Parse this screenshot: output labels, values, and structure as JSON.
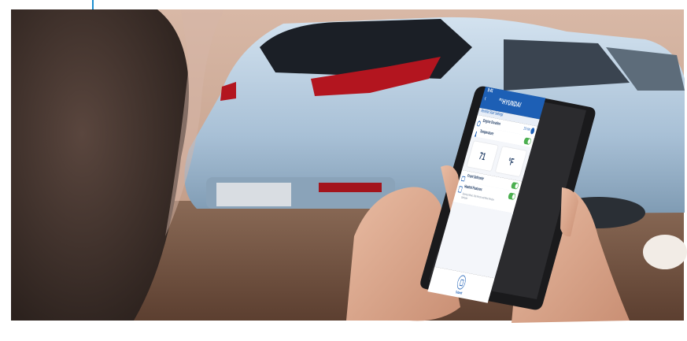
{
  "app": {
    "status_time": "9:41",
    "brand": "myHYUNDAI",
    "brand_prefix": "my",
    "brand_name": "HYUNDAI",
    "screen_title": "Remote Start Settings"
  },
  "settings": {
    "engine_duration": {
      "label": "Engine Duration",
      "value": "10 min"
    },
    "temperature": {
      "label": "Temperature",
      "enabled": true,
      "value": "71",
      "unit": "°F"
    },
    "front_defroster": {
      "label": "Front Defroster",
      "enabled": true
    },
    "heated_features": {
      "label": "Heated Features",
      "enabled": true,
      "description": "Steering Wheel, Side Mirrors and Rear Window Defroster"
    }
  },
  "footer": {
    "submit_label": "Submit"
  },
  "icons": [
    "back-arrow-icon",
    "engine-icon",
    "temperature-icon",
    "defroster-icon",
    "heated-features-icon",
    "submit-icon",
    "info-icon"
  ],
  "colors": {
    "accent": "#1d5fb5",
    "toggle_on": "#4caf50",
    "car": "#b6cde0",
    "taillight": "#b3151f"
  }
}
